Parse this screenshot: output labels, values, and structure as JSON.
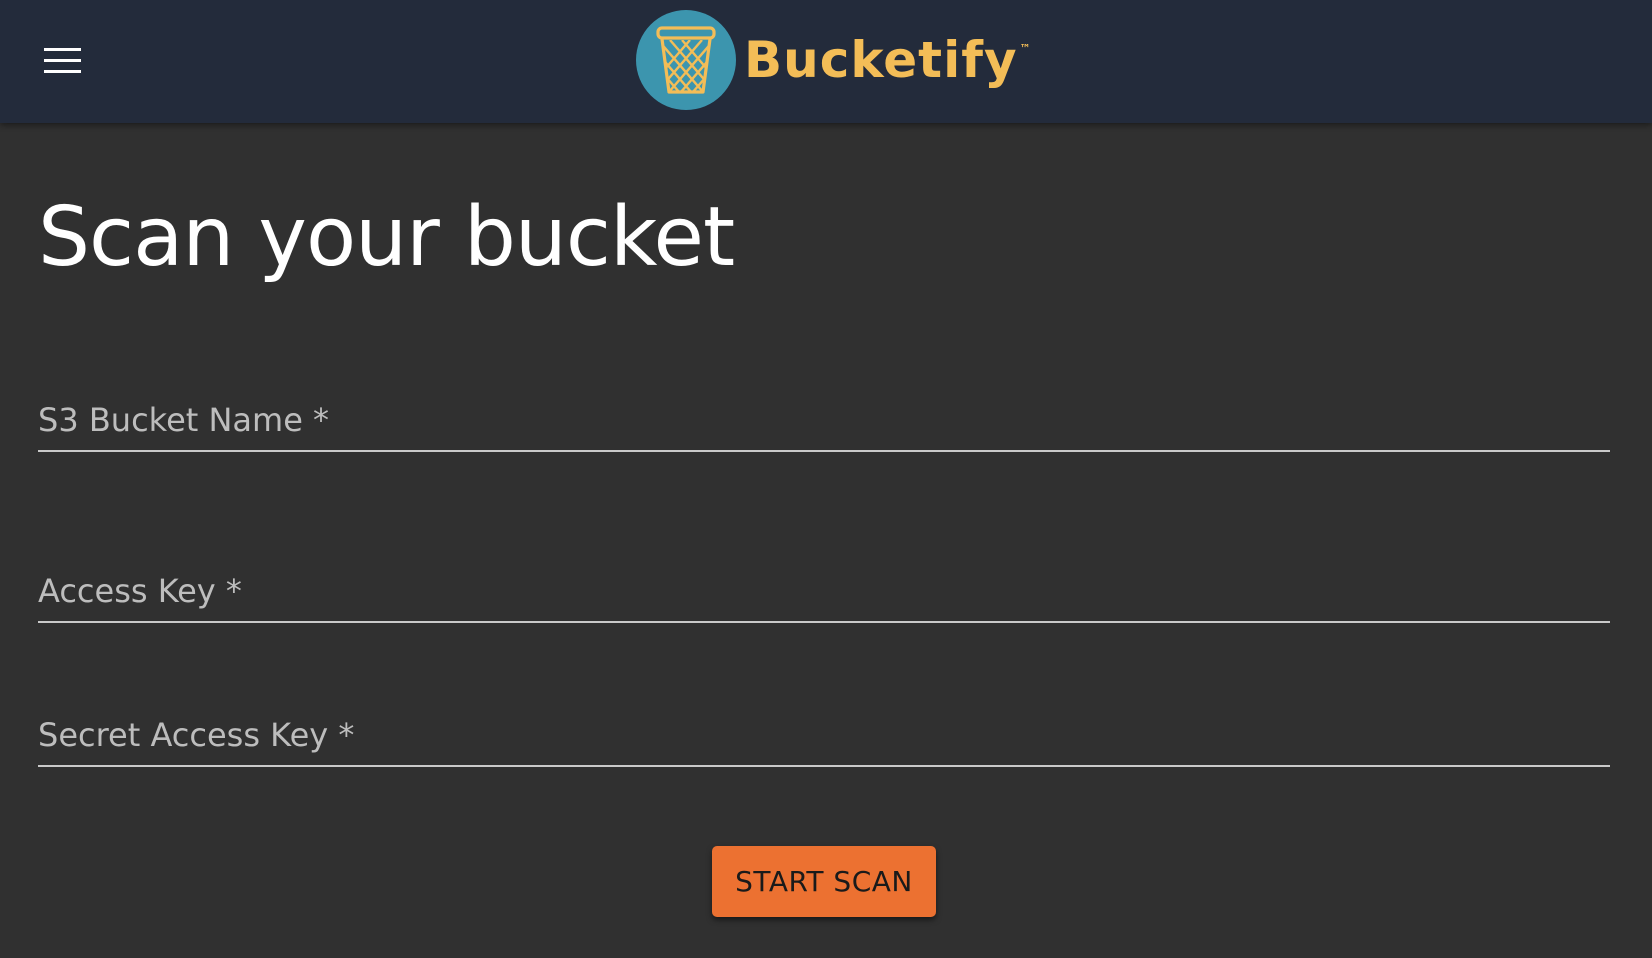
{
  "header": {
    "menu_icon": "hamburger-menu-icon",
    "logo_icon": "trash-basket-icon",
    "brand_name": "Bucketify",
    "trademark": "™",
    "colors": {
      "bar_background": "#232b3b",
      "logo_circle": "#3c95ae",
      "brand_text": "#f3bd57"
    }
  },
  "main": {
    "title": "Scan your bucket",
    "form": {
      "bucket_name": {
        "value": "",
        "placeholder": "S3 Bucket Name *"
      },
      "access_key": {
        "value": "",
        "placeholder": "Access Key *"
      },
      "secret_access_key": {
        "value": "",
        "placeholder": "Secret Access Key *"
      },
      "submit_label": "START SCAN"
    }
  },
  "colors": {
    "page_background": "#303030",
    "accent": "#ec7131",
    "input_underline": "#c9c9c9"
  }
}
